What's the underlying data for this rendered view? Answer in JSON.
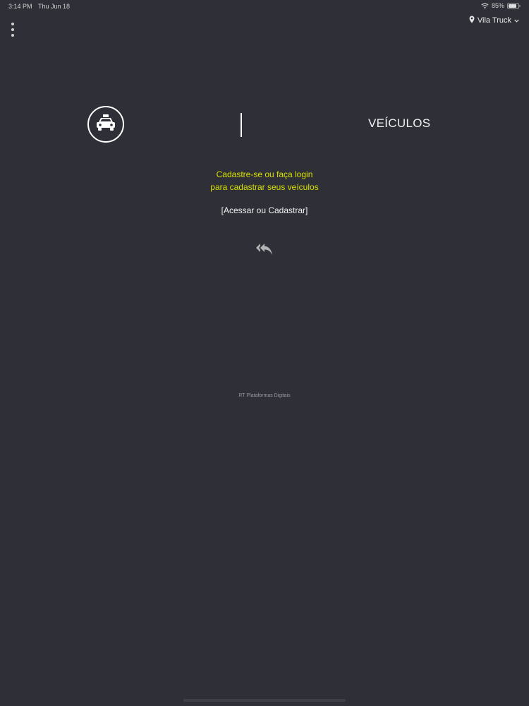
{
  "status_bar": {
    "time": "3:14 PM",
    "date": "Thu Jun 18",
    "battery": "85%"
  },
  "location": {
    "label": "Vila Truck",
    "icon": "map-pin-icon"
  },
  "header": {
    "title": "VEÍCULOS",
    "icon": "taxi-icon"
  },
  "prompt": {
    "line1": "Cadastre-se ou faça login",
    "line2": "para cadastrar seus veículos"
  },
  "actions": {
    "access_label": "[Acessar ou Cadastrar]",
    "back_icon": "reply-all-icon"
  },
  "footer": {
    "credit": "RT Plataformas Digitais"
  },
  "colors": {
    "background": "#2f3037",
    "accent": "#d6e000",
    "text": "#f0f0f0"
  }
}
